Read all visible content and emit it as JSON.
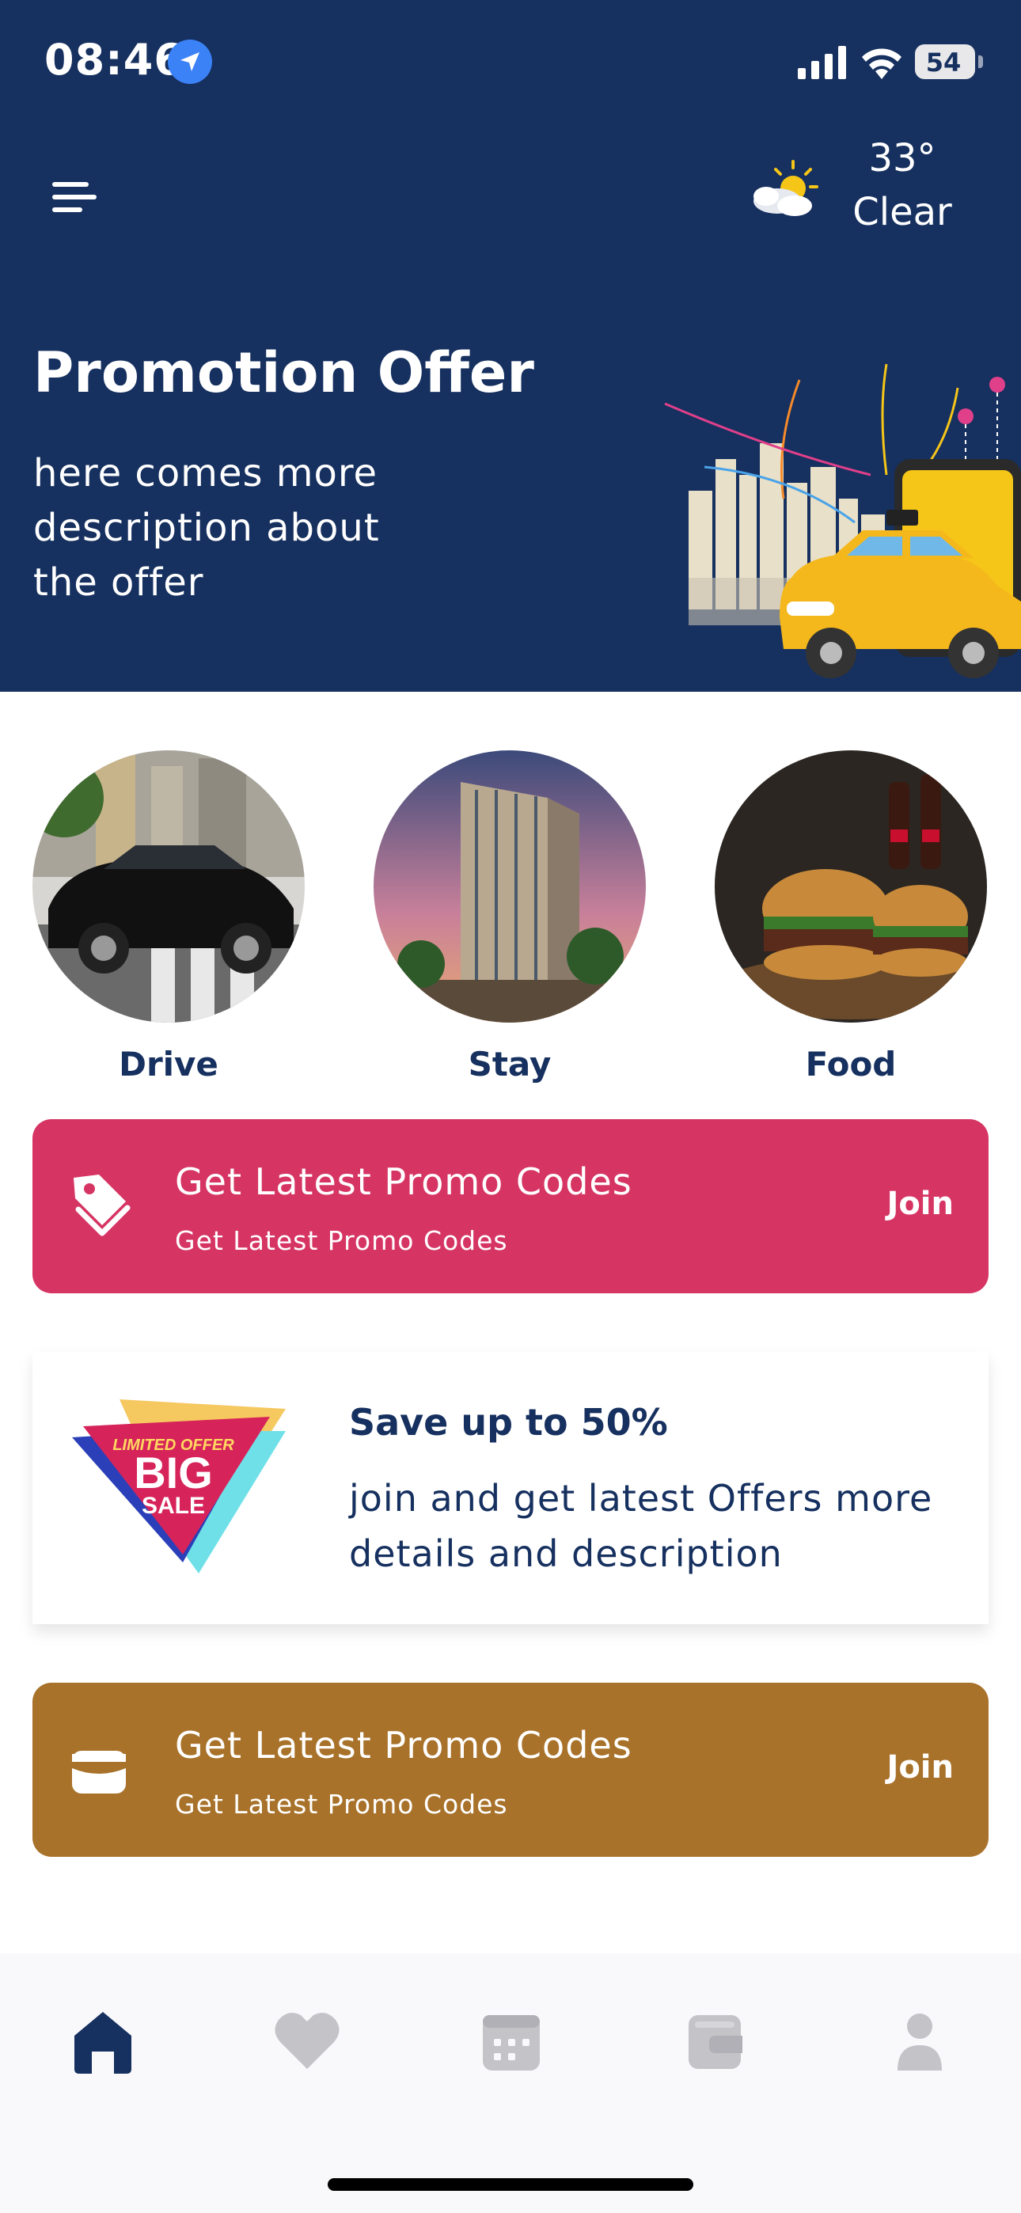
{
  "status_bar": {
    "time": "08:46",
    "battery": "54"
  },
  "header": {
    "weather": {
      "temp": "33°",
      "condition": "Clear"
    },
    "promo_title": "Promotion Offer",
    "promo_description": "here comes more description about the offer"
  },
  "categories": [
    {
      "label": "Drive",
      "icon": "car-image"
    },
    {
      "label": "Stay",
      "icon": "hotel-image"
    },
    {
      "label": "Food",
      "icon": "burger-image"
    }
  ],
  "promo_cards": [
    {
      "title": "Get Latest Promo Codes",
      "subtitle": "Get Latest Promo Codes",
      "action": "Join",
      "icon": "tag-icon",
      "color": "#d63564"
    },
    {
      "title": "Get Latest Promo Codes",
      "subtitle": "Get Latest Promo Codes",
      "action": "Join",
      "icon": "wallet-icon",
      "color": "#a8722a"
    }
  ],
  "sale_card": {
    "badge_top": "LIMITED OFFER",
    "badge_main": "BIG",
    "badge_sub": "SALE",
    "title": "Save up to 50%",
    "description": "join and get latest Offers more details and description"
  },
  "nav": [
    {
      "icon": "home-icon",
      "active": true
    },
    {
      "icon": "heart-icon",
      "active": false
    },
    {
      "icon": "calendar-icon",
      "active": false
    },
    {
      "icon": "wallet-icon",
      "active": false
    },
    {
      "icon": "profile-icon",
      "active": false
    }
  ],
  "colors": {
    "primary": "#16305f",
    "pink": "#d63564",
    "gold": "#a8722a",
    "nav_inactive": "#c4c4c8"
  }
}
